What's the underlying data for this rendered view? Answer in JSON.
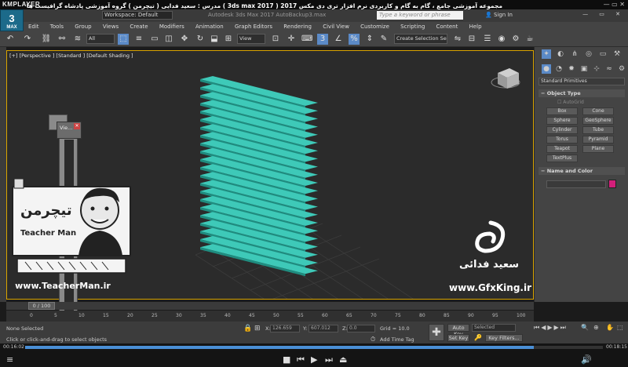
{
  "player": {
    "logo": "KMPLAYER",
    "window_controls": "— ▭ ✕",
    "elapsed": "00:16:02",
    "duration": "00:18:15",
    "progress": 0.88
  },
  "course_title": "مجموعه آموزشی جامع ، گام به گام و کاربردی نرم افزار تری دی مکس 2017 ( 3ds max 2017 )   مدرس : سعید فدایی ( تیچرمن ) گروه آموزشی پادشاه گرافیست ها",
  "app": {
    "logo": "3",
    "logo_sub": "MAX",
    "workspace": "Workspace: Default",
    "title": "Autodesk 3ds Max 2017    AutoBackup3.max",
    "search_placeholder": "Type a keyword or phrase",
    "signin": "Sign In"
  },
  "menu": [
    "Edit",
    "Tools",
    "Group",
    "Views",
    "Create",
    "Modifiers",
    "Animation",
    "Graph Editors",
    "Rendering",
    "Civil View",
    "Customize",
    "Scripting",
    "Content",
    "Help"
  ],
  "toolbar": {
    "filter": "All",
    "ref_coord": "View",
    "selection_set": "Create Selection Se"
  },
  "viewport": {
    "label": "[+] [Perspective ] [Standard ] [Default Shading ]",
    "mini_window_label": "Vie..."
  },
  "command_panel": {
    "category": "Standard Primitives",
    "object_type_title": "Object Type",
    "autogrid": "AutoGrid",
    "primitives": [
      "Box",
      "Cone",
      "Sphere",
      "GeoSphere",
      "Cylinder",
      "Tube",
      "Torus",
      "Pyramid",
      "Teapot",
      "Plane",
      "TextPlus"
    ],
    "name_color_title": "Name and Color",
    "swatch_color": "#d41f7a"
  },
  "timeline": {
    "frame_display": "0 / 100",
    "ticks": [
      "0",
      "5",
      "10",
      "15",
      "20",
      "25",
      "30",
      "35",
      "40",
      "45",
      "50",
      "55",
      "60",
      "65",
      "70",
      "75",
      "80",
      "85",
      "90",
      "95",
      "100"
    ]
  },
  "status": {
    "selection": "None Selected",
    "prompt": "Click or click-and-drag to select objects",
    "x_label": "X:",
    "x_value": "126.659",
    "y_label": "Y:",
    "y_value": "607.012",
    "z_label": "Z:",
    "z_value": "0.0",
    "grid": "Grid = 10.0",
    "add_time_tag": "Add Time Tag",
    "auto_key": "Auto Key",
    "set_key": "Set Key",
    "selected": "Selected",
    "key_filters": "Key Filters..."
  },
  "watermarks": {
    "teacherman_url": "www.TeacherMan.ir",
    "gfxking_url": "www.GfxKing.ir",
    "author_name": "سعید فدائی"
  },
  "colors": {
    "blinds": "#3ec9b8",
    "active_border": "#d9a400"
  }
}
